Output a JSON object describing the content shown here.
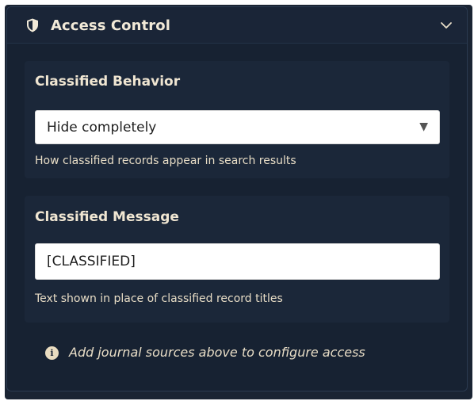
{
  "header": {
    "title": "Access Control",
    "icon": "shield-icon",
    "toggle_icon": "chevron-down-icon"
  },
  "classified_behavior": {
    "title": "Classified Behavior",
    "selected": "Hide completely",
    "dropdown_icon": "triangle-down-icon",
    "help": "How classified records appear in search results"
  },
  "classified_message": {
    "title": "Classified Message",
    "value": "[CLASSIFIED]",
    "help": "Text shown in place of classified record titles"
  },
  "note": {
    "icon": "info-icon",
    "text": "Add journal sources above to configure access"
  },
  "colors": {
    "panel_bg": "#172232",
    "section_bg": "#1b2739",
    "text": "#f0e6d2"
  }
}
